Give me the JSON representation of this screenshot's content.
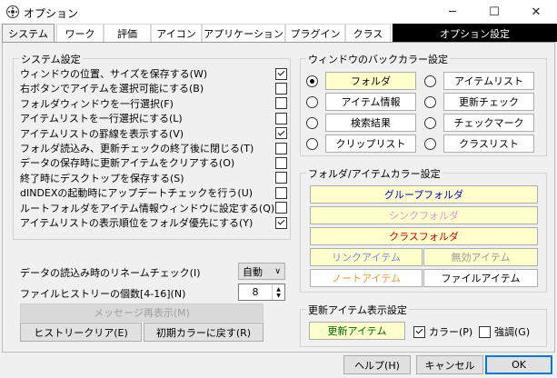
{
  "window": {
    "title": "オプション",
    "minimize": "─",
    "maximize": "☐",
    "close": "✕"
  },
  "tabs": [
    "システム",
    "ワーク",
    "評価",
    "アイコン",
    "アプリケーション",
    "プラグイン",
    "クラス",
    "オプション設定"
  ],
  "system": {
    "group_label": "システム設定",
    "options": [
      {
        "label": "ウィンドウの位置、サイズを保存する(W)",
        "checked": true
      },
      {
        "label": "右ボタンでアイテムを選択可能にする(B)",
        "checked": false
      },
      {
        "label": "フォルダウィンドウを一行選択(F)",
        "checked": false
      },
      {
        "label": "アイテムリストを一行選択にする(L)",
        "checked": false
      },
      {
        "label": "アイテムリストの罫線を表示する(V)",
        "checked": true
      },
      {
        "label": "フォルダ読込み、更新チェックの終了後に閉じる(T)",
        "checked": false
      },
      {
        "label": "データの保存時に更新アイテムをクリアする(O)",
        "checked": false
      },
      {
        "label": "終了時にデスクトップを保存する(S)",
        "checked": false
      },
      {
        "label": "dINDEXの起動時にアップデートチェックを行う(U)",
        "checked": false
      },
      {
        "label": "ルートフォルダをアイテム情報ウィンドウに設定する(Q)",
        "checked": false
      },
      {
        "label": "アイテムリストの表示順位をフォルダ優先にする(Y)",
        "checked": true
      }
    ],
    "rename_label": "データの読込み時のリネームチェック(I)",
    "rename_value": "自動",
    "history_label": "ファイルヒストリーの個数[4-16](N)",
    "history_value": "8",
    "message_button": "メッセージ再表示(M)",
    "history_clear": "ヒストリークリア(E)",
    "reset_colors": "初期カラーに戻す(R)"
  },
  "window_colors": {
    "group_label": "ウィンドウのバックカラー設定",
    "items": [
      {
        "label": "フォルダ",
        "selected": true,
        "bg": "#ffffcc"
      },
      {
        "label": "アイテムリスト",
        "selected": false,
        "bg": "#ffffff"
      },
      {
        "label": "アイテム情報",
        "selected": false,
        "bg": "#ffffff"
      },
      {
        "label": "更新チェック",
        "selected": false,
        "bg": "#ffffff"
      },
      {
        "label": "検索結果",
        "selected": false,
        "bg": "#ffffff"
      },
      {
        "label": "チェックマーク",
        "selected": false,
        "bg": "#ffffff"
      },
      {
        "label": "クリップリスト",
        "selected": false,
        "bg": "#ffffff"
      },
      {
        "label": "クラスリスト",
        "selected": false,
        "bg": "#ffffff"
      }
    ]
  },
  "item_colors": {
    "group_label": "フォルダ/アイテムカラー設定",
    "items": [
      {
        "label": "グループフォルダ",
        "color": "#0000cc",
        "bg": "#ffffcc"
      },
      {
        "label": "シンクフォルダ",
        "color": "#d89adb",
        "bg": "#ffffcc"
      },
      {
        "label": "クラスフォルダ",
        "color": "#cc0000",
        "bg": "#ffffcc"
      },
      {
        "label": "リンクアイテム",
        "color": "#6f93d8",
        "bg": "#ffffcc"
      },
      {
        "label": "無効アイテム",
        "color": "#999999",
        "bg": "#ffffcc"
      },
      {
        "label": "ノートアイテム",
        "color": "#e79a3b",
        "bg": "#ffffff"
      },
      {
        "label": "ファイルアイテム",
        "color": "#000000",
        "bg": "#ffffff"
      }
    ]
  },
  "update_display": {
    "group_label": "更新アイテム表示設定",
    "sample": "更新アイテム",
    "sample_color": "#006600",
    "sample_bg": "#ffffcc",
    "color_label": "カラー(P)",
    "color_checked": true,
    "emphasis_label": "強調(G)",
    "emphasis_checked": false
  },
  "footer": {
    "help": "ヘルプ(H)",
    "cancel": "キャンセル",
    "ok": "OK"
  }
}
